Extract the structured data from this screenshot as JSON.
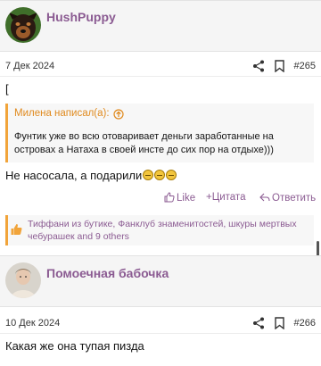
{
  "post1": {
    "username": "HushPuppy",
    "date": "7 Дек 2024",
    "number": "#265",
    "stray_char": "[",
    "quote": {
      "header": "Милена написал(а):",
      "body": "Фунтик уже во всю отоваривает деньги заработанные на островах а Натаха в своей инсте до сих пор на отдыхе)))"
    },
    "body_text": "Не насосала, а подарили",
    "actions": {
      "like": "Like",
      "quote": "Цитата",
      "reply": "Ответить"
    },
    "reactions_line1": "Тиффани из бутике, Фанклуб знаменитостей, шкуры мертвых",
    "reactions_line2": "чебурашек and 9 others"
  },
  "post2": {
    "username": "Помоечная бабочка",
    "date": "10 Дек 2024",
    "number": "#266",
    "body_text": "Какая же она тупая пизда"
  },
  "icons": {
    "share": "share-icon",
    "bookmark": "bookmark-icon",
    "quote_jump": "arrow-up-circle-icon",
    "like": "thumbs-up-outline-icon",
    "quote_plus": "plus-icon",
    "reply": "reply-icon",
    "reaction": "thumbs-up-icon"
  },
  "colors": {
    "username": "#8b5b92",
    "quote_accent": "#f1a43a",
    "quote_header": "#e08a1e"
  }
}
